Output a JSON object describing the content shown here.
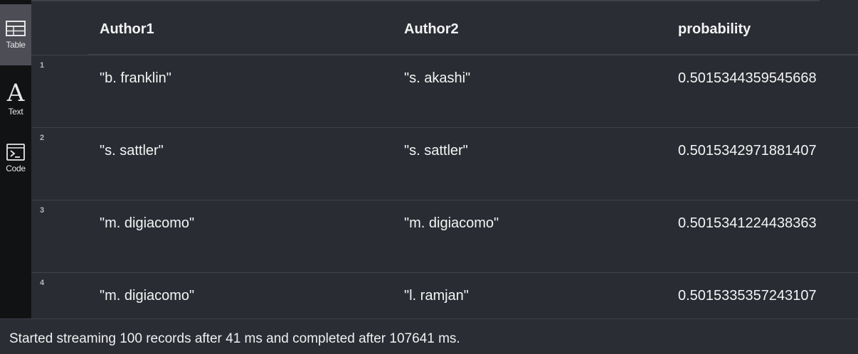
{
  "sidebar": {
    "items": [
      {
        "label": "Table",
        "icon": "table-icon"
      },
      {
        "label": "Text",
        "icon": "text-icon",
        "glyph": "A"
      },
      {
        "label": "Code",
        "icon": "code-icon"
      }
    ]
  },
  "table": {
    "columns": [
      "Author1",
      "Author2",
      "probability"
    ],
    "rows": [
      {
        "num": "1",
        "author1": "\"b. franklin\"",
        "author2": "\"s. akashi\"",
        "probability": "0.5015344359545668"
      },
      {
        "num": "2",
        "author1": "\"s. sattler\"",
        "author2": "\"s. sattler\"",
        "probability": "0.5015342971881407"
      },
      {
        "num": "3",
        "author1": "\"m. digiacomo\"",
        "author2": "\"m. digiacomo\"",
        "probability": "0.5015341224438363"
      },
      {
        "num": "4",
        "author1": "\"m. digiacomo\"",
        "author2": "\"l. ramjan\"",
        "probability": "0.5015335357243107"
      }
    ]
  },
  "status": {
    "message": "Started streaming 100 records after 41 ms and completed after 107641 ms."
  }
}
